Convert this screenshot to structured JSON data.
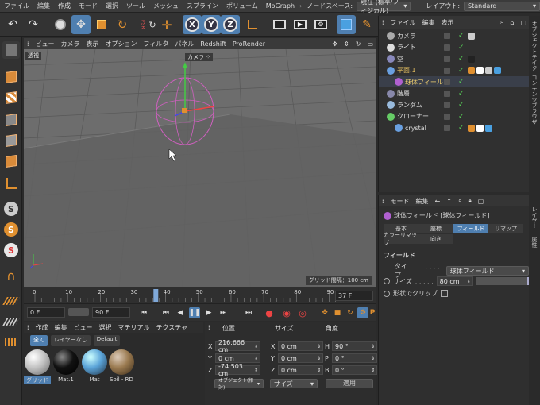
{
  "menubar": {
    "items": [
      "ファイル",
      "編集",
      "作成",
      "モード",
      "選択",
      "ツール",
      "メッシュ",
      "スプライン",
      "ボリューム",
      "MoGraph"
    ],
    "node_space_label": "ノードスペース:",
    "node_space_value": "現在 (標準/フィジカル)",
    "layout_label": "レイアウト:",
    "layout_value": "Standard"
  },
  "toolbar": {
    "axis_x": "X",
    "axis_y": "Y",
    "axis_z": "Z",
    "psr": "PSR"
  },
  "viewport": {
    "menu": [
      "ビュー",
      "カメラ",
      "表示",
      "オプション",
      "フィルタ",
      "パネル",
      "Redshift",
      "ProRender"
    ],
    "view_name": "透視",
    "camera_label": "カメラ",
    "grid_spacing": "グリッド間隔：100 cm"
  },
  "timeline": {
    "ticks": [
      "0",
      "10",
      "20",
      "30",
      "40",
      "50",
      "60",
      "70",
      "80",
      "90"
    ],
    "current_frame_display": "37 F",
    "start_frame": "0 F",
    "end_frame": "90 F",
    "playhead_frame": 37
  },
  "materials": {
    "menu": [
      "作成",
      "編集",
      "ビュー",
      "選択",
      "マテリアル",
      "テクスチャ"
    ],
    "filters": [
      "全て",
      "レイヤーなし",
      "Default"
    ],
    "items": [
      {
        "name": "グリッド",
        "color": "#e8e8e8"
      },
      {
        "name": "Mat.1",
        "color": "#1a1a1a"
      },
      {
        "name": "Mat",
        "color": "#5aa3d8"
      },
      {
        "name": "Soil - RD",
        "color": "#9a7a50"
      }
    ]
  },
  "coords": {
    "headers": {
      "position": "位置",
      "size": "サイズ",
      "angle": "角度"
    },
    "rows": [
      {
        "axis": "X",
        "pos": "216.666 cm",
        "size_axis": "X",
        "size": "0 cm",
        "rot_axis": "H",
        "rot": "90 °"
      },
      {
        "axis": "Y",
        "pos": "0 cm",
        "size_axis": "Y",
        "size": "0 cm",
        "rot_axis": "P",
        "rot": "0 °"
      },
      {
        "axis": "Z",
        "pos": "-74.503 cm",
        "size_axis": "Z",
        "size": "0 cm",
        "rot_axis": "B",
        "rot": "0 °"
      }
    ],
    "mode_select": "オブジェクト(相対)",
    "size_select": "サイズ",
    "apply_button": "適用"
  },
  "object_manager": {
    "menu": [
      "ファイル",
      "編集",
      "表示"
    ],
    "objects": [
      {
        "name": "カメラ",
        "icon": "camera-icon",
        "color": "#aaa",
        "indent": 1
      },
      {
        "name": "ライト",
        "icon": "light-icon",
        "color": "#ddd",
        "indent": 1
      },
      {
        "name": "空",
        "icon": "sky-icon",
        "color": "#88b",
        "indent": 1
      },
      {
        "name": "平面.1",
        "icon": "plane-icon",
        "color": "#6aa0e0",
        "indent": 1
      },
      {
        "name": "球体フィールド",
        "icon": "sphere-field-icon",
        "color": "#b060d0",
        "indent": 2
      },
      {
        "name": "階層",
        "icon": "hierarchy-icon",
        "color": "#88a",
        "indent": 1
      },
      {
        "name": "ランダム",
        "icon": "random-icon",
        "color": "#9bd",
        "indent": 1
      },
      {
        "name": "クローナー",
        "icon": "cloner-icon",
        "color": "#6c6",
        "indent": 1
      },
      {
        "name": "crystal",
        "icon": "crystal-icon",
        "color": "#6aa0e0",
        "indent": 2
      }
    ]
  },
  "attributes": {
    "menu": [
      "モード",
      "編集"
    ],
    "title": "球体フィールド [球体フィールド]",
    "tabs": [
      "基本",
      "座標",
      "フィールド",
      "リマップ",
      "カラーリマップ",
      "向き"
    ],
    "active_tab": "フィールド",
    "section": "フィールド",
    "type_label": "タイプ",
    "type_value": "球体フィールド",
    "size_label": "サイズ",
    "size_value": "80 cm",
    "clip_label": "形状でクリップ"
  },
  "side_tabs": [
    "オブジェクト",
    "テイク",
    "コンテンツブラウザ",
    "レイヤー",
    "属性"
  ],
  "colors": {
    "accent": "#4f7fb0",
    "viewport_floor": "#6b6b6b"
  }
}
